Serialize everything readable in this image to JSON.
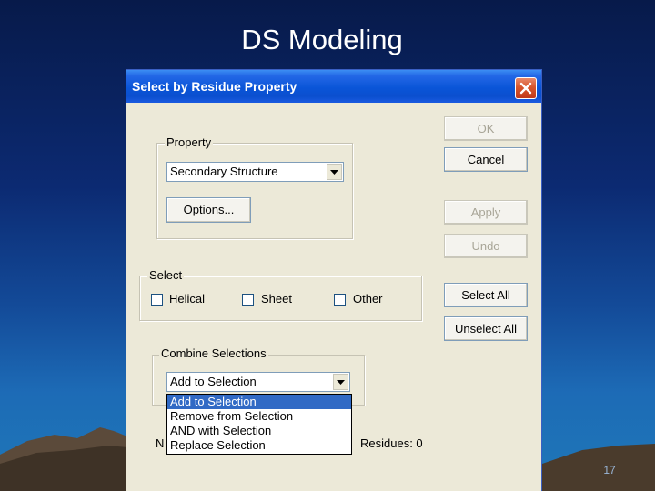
{
  "slide": {
    "title": "DS Modeling",
    "page_number": "17"
  },
  "dialog": {
    "title": "Select by Residue Property",
    "buttons": {
      "ok": "OK",
      "cancel": "Cancel",
      "apply": "Apply",
      "undo": "Undo",
      "select_all": "Select All",
      "unselect_all": "Unselect All"
    },
    "property": {
      "group_label": "Property",
      "selected": "Secondary Structure",
      "options_button": "Options..."
    },
    "select": {
      "group_label": "Select",
      "checkboxes": [
        {
          "label": "Helical",
          "checked": false
        },
        {
          "label": "Sheet",
          "checked": false
        },
        {
          "label": "Other",
          "checked": false
        }
      ]
    },
    "combine": {
      "group_label": "Combine Selections",
      "selected": "Add to Selection",
      "options": [
        "Add to Selection",
        "Remove from Selection",
        "AND with Selection",
        "Replace Selection"
      ]
    },
    "status": {
      "left_partial": "N",
      "residues": "Residues: 0"
    }
  },
  "colors": {
    "titlebar": "#0b4fcf",
    "selected_item": "#316ac5",
    "dialog_face": "#ece9d8"
  }
}
